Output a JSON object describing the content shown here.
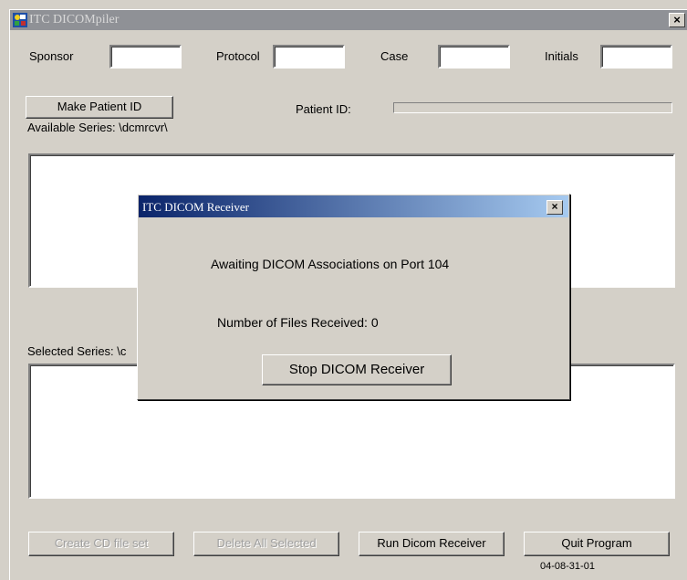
{
  "window": {
    "title": "ITC DICOMpiler",
    "close": "×"
  },
  "form": {
    "sponsor_label": "Sponsor",
    "sponsor_value": "",
    "protocol_label": "Protocol",
    "protocol_value": "",
    "case_label": "Case",
    "case_value": "",
    "initials_label": "Initials",
    "initials_value": "",
    "make_patient_id": "Make Patient ID",
    "patient_id_label": "Patient ID:",
    "patient_id_value": "",
    "available_series_label": "Available Series:  \\dcmrcvr\\",
    "selected_series_label": "Selected Series:  \\c"
  },
  "buttons": {
    "create_cd": "Create CD file set",
    "delete_all": "Delete All Selected",
    "run_receiver": "Run Dicom Receiver",
    "quit": "Quit Program"
  },
  "version": "04-08-31-01",
  "dialog": {
    "title": "ITC DICOM Receiver",
    "close": "×",
    "awaiting": "Awaiting DICOM Associations on Port 104",
    "files_received": "Number of Files Received: 0",
    "stop_button": "Stop  DICOM Receiver"
  },
  "colors": {
    "titlebar_inactive": "#8f9196",
    "dialog_title_start": "#0a246a",
    "dialog_title_end": "#a6caf0",
    "face": "#d4d0c8"
  }
}
